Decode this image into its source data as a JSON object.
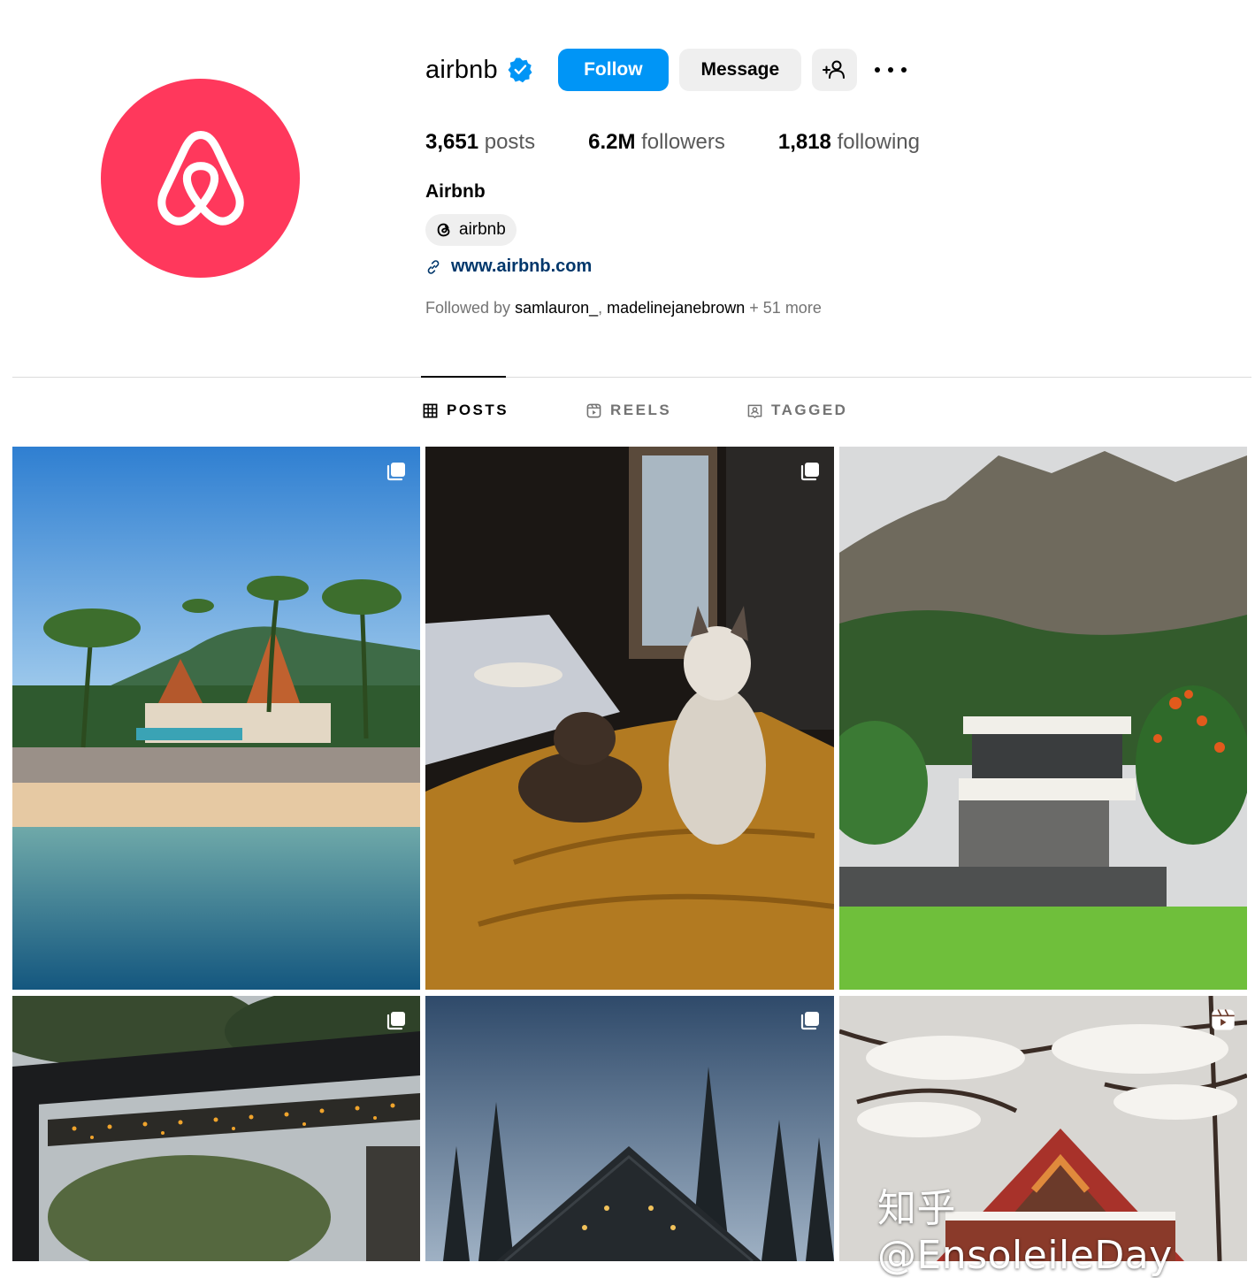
{
  "profile": {
    "username": "airbnb",
    "verified": true,
    "brand_color": "#ff385c",
    "full_name": "Airbnb",
    "threads_handle": "airbnb",
    "website": "www.airbnb.com"
  },
  "actions": {
    "follow_label": "Follow",
    "message_label": "Message",
    "follow_color": "#0095f6"
  },
  "stats": {
    "posts_count": "3,651",
    "posts_label": "posts",
    "followers_count": "6.2M",
    "followers_label": "followers",
    "following_count": "1,818",
    "following_label": "following"
  },
  "followed_by": {
    "prefix": "Followed by",
    "user1": "samlauron_",
    "separator": ",",
    "user2": "madelinejanebrown",
    "suffix": "+ 51 more"
  },
  "tabs": [
    {
      "label": "POSTS",
      "icon": "grid-icon",
      "active": true
    },
    {
      "label": "REELS",
      "icon": "reels-icon",
      "active": false
    },
    {
      "label": "TAGGED",
      "icon": "tagged-icon",
      "active": false
    }
  ],
  "posts": [
    {
      "subject": "beach-villa",
      "badge": "carousel-icon"
    },
    {
      "subject": "dogs-on-bed",
      "badge": "carousel-icon"
    },
    {
      "subject": "mountain-house",
      "badge": "none"
    },
    {
      "subject": "pergola-lights",
      "badge": "carousel-icon"
    },
    {
      "subject": "a-frame-cabin",
      "badge": "carousel-icon"
    },
    {
      "subject": "snowy-cabin",
      "badge": "reel-icon"
    }
  ],
  "watermark": "知乎 @EnsoleileDay"
}
